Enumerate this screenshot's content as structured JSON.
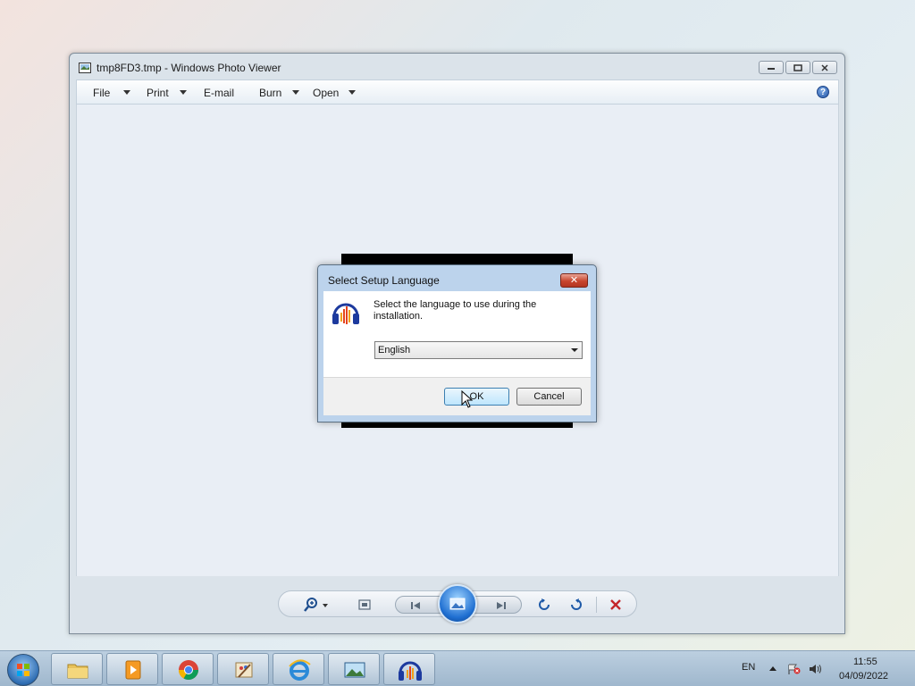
{
  "window": {
    "title": "tmp8FD3.tmp - Windows Photo Viewer"
  },
  "menu": {
    "items": [
      {
        "label": "File",
        "has_arrow": true
      },
      {
        "label": "Print",
        "has_arrow": true
      },
      {
        "label": "E-mail",
        "has_arrow": false
      },
      {
        "label": "Burn",
        "has_arrow": true
      },
      {
        "label": "Open",
        "has_arrow": true
      }
    ],
    "help": "?"
  },
  "dialog": {
    "title": "Select Setup Language",
    "message": "Select the language to use during the installation.",
    "language_value": "English",
    "ok_label": "OK",
    "cancel_label": "Cancel"
  },
  "toolbar": {
    "icons": [
      "zoom-icon",
      "actual-size-icon",
      "previous-icon",
      "slideshow-icon",
      "next-icon",
      "rotate-counterclockwise-icon",
      "rotate-clockwise-icon",
      "delete-icon"
    ]
  },
  "taskbar": {
    "apps": [
      "windows-explorer",
      "media-player",
      "chrome",
      "paint",
      "internet-explorer",
      "photo-viewer",
      "audacity"
    ],
    "lang": "EN",
    "time": "11:55",
    "date": "04/09/2022"
  },
  "colors": {
    "accent": "#2e6db3",
    "close_red": "#c8452e"
  }
}
